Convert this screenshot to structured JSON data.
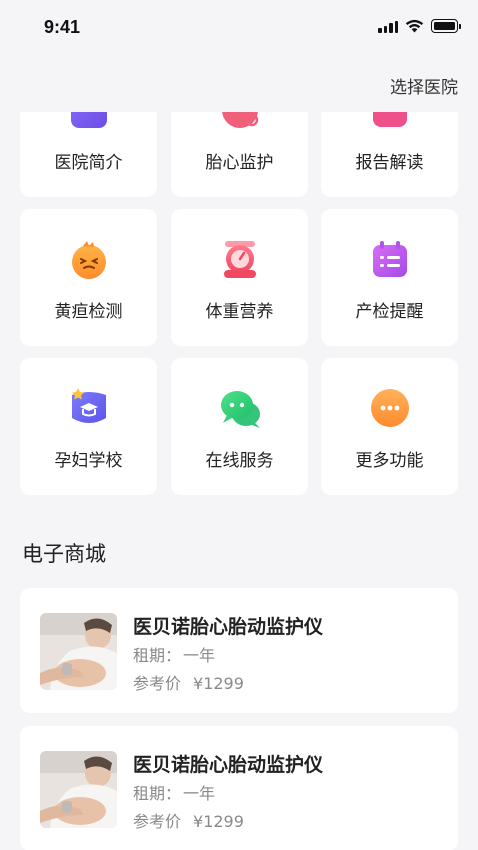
{
  "status_bar": {
    "time": "9:41"
  },
  "header": {
    "select_hospital": "选择医院"
  },
  "menu": [
    {
      "label": "医院简介",
      "icon": "hospital-icon"
    },
    {
      "label": "胎心监护",
      "icon": "fetal-heart-icon"
    },
    {
      "label": "报告解读",
      "icon": "report-icon"
    },
    {
      "label": "黄疸检测",
      "icon": "jaundice-icon"
    },
    {
      "label": "体重营养",
      "icon": "scale-icon"
    },
    {
      "label": "产检提醒",
      "icon": "calendar-icon"
    },
    {
      "label": "孕妇学校",
      "icon": "school-icon"
    },
    {
      "label": "在线服务",
      "icon": "chat-icon"
    },
    {
      "label": "更多功能",
      "icon": "more-icon"
    }
  ],
  "mall": {
    "title": "电子商城",
    "products": [
      {
        "name": "医贝诺胎心胎动监护仪",
        "period_label": "租期：",
        "period": "一年",
        "price_label": "参考价",
        "price": "¥1299"
      },
      {
        "name": "医贝诺胎心胎动监护仪",
        "period_label": "租期：",
        "period": "一年",
        "price_label": "参考价",
        "price": "¥1299"
      }
    ]
  }
}
